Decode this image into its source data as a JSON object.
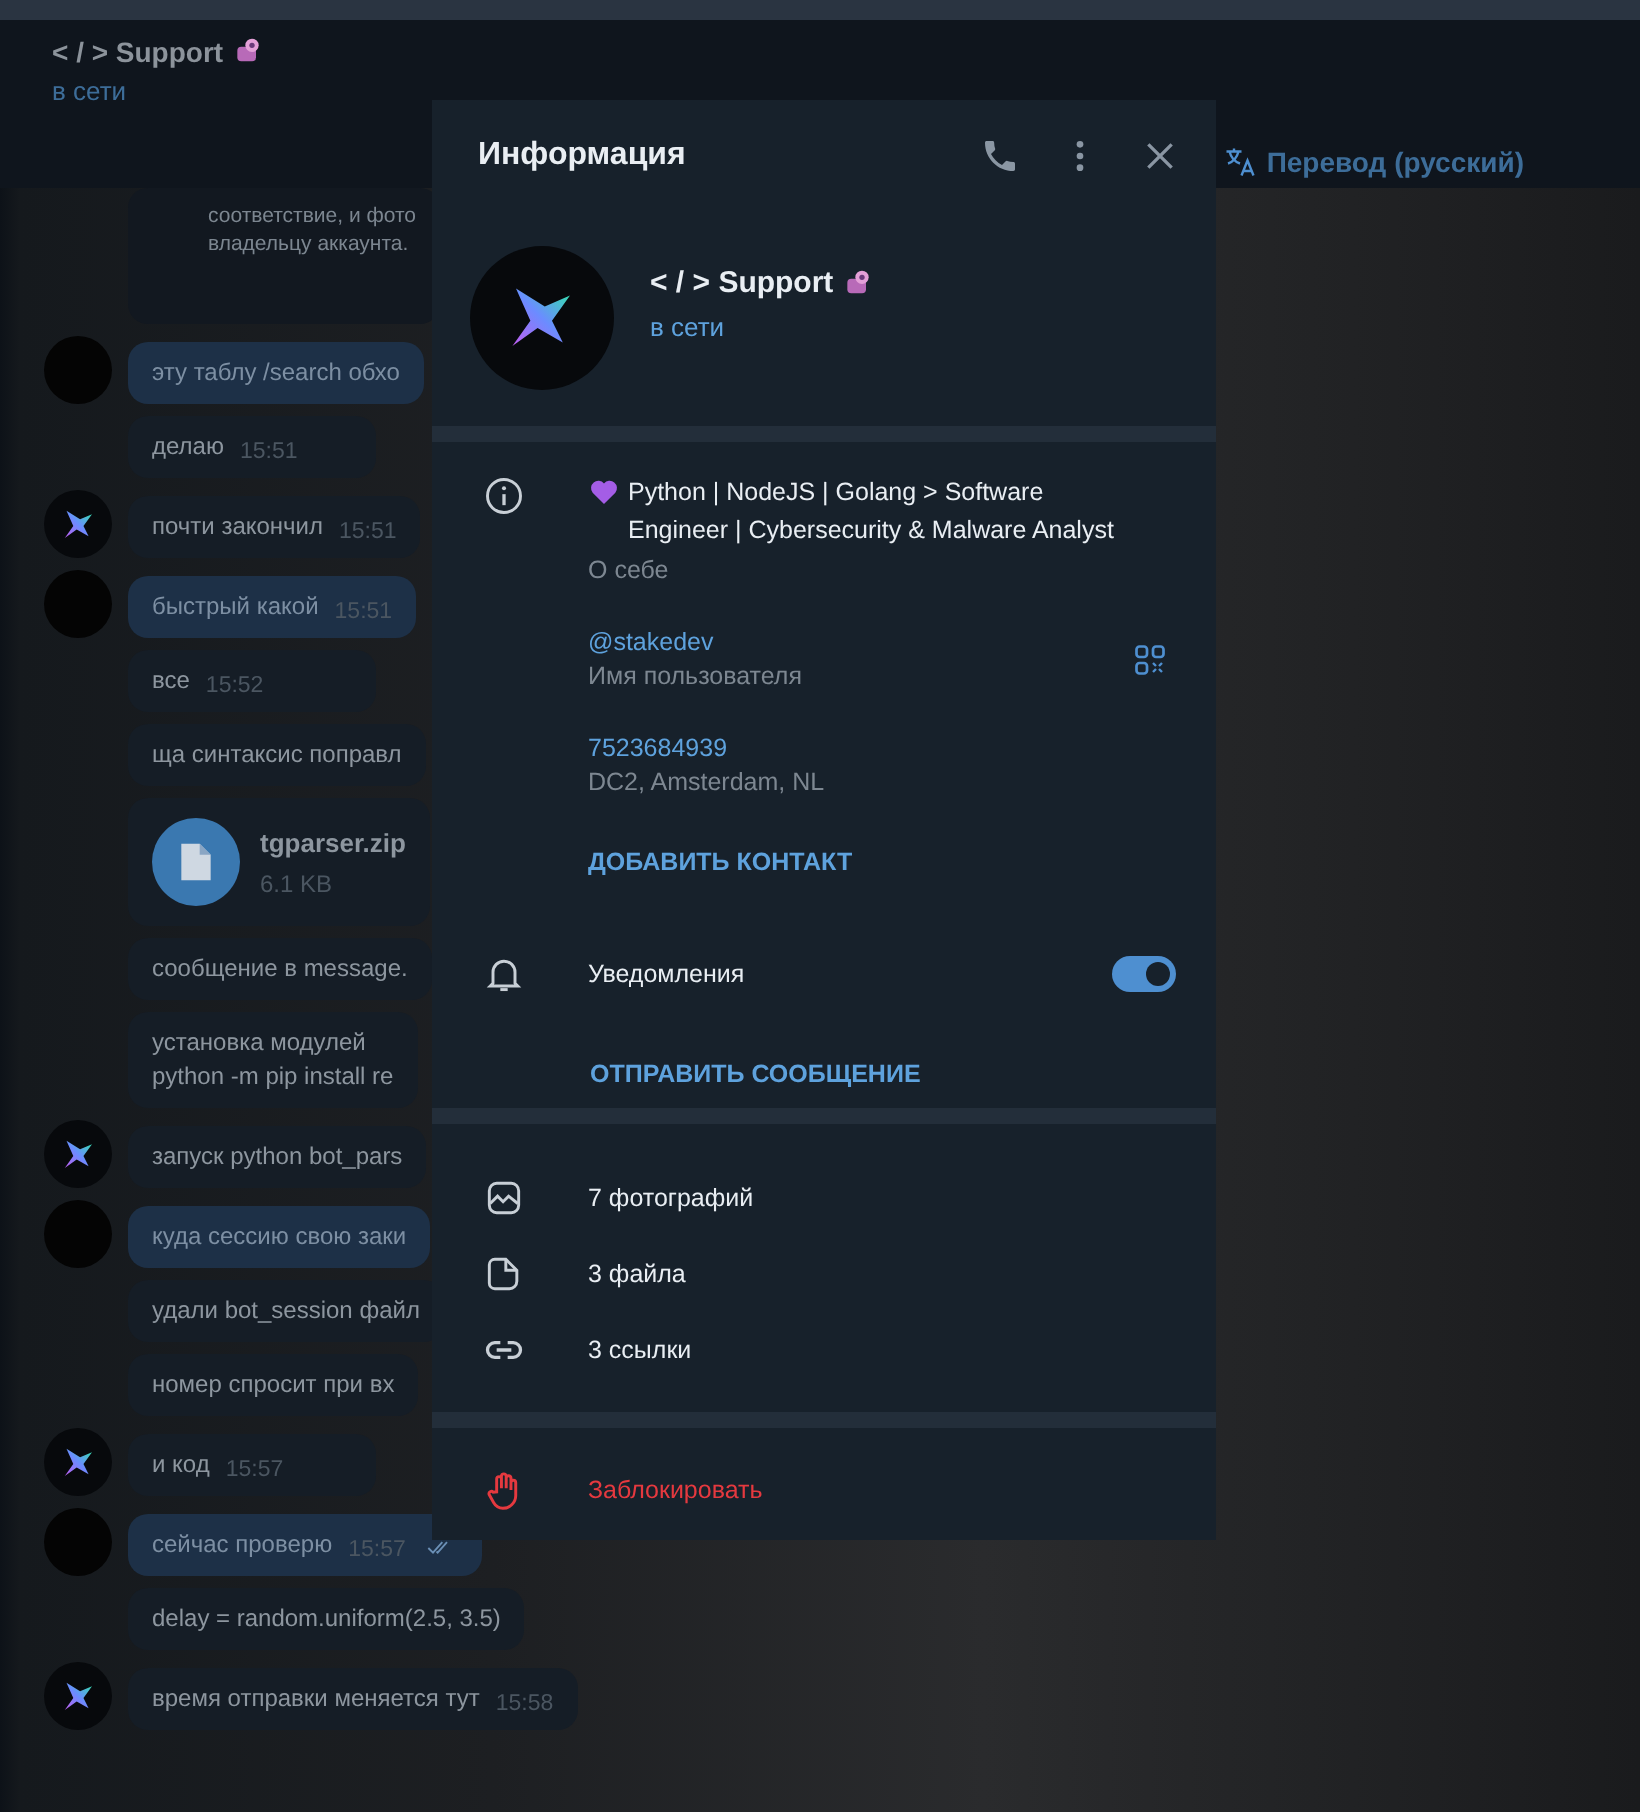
{
  "header": {
    "title": "< / > Support",
    "status": "в сети",
    "translate": "Перевод (русский)"
  },
  "messages": [
    {
      "kind": "card",
      "lines": [
        "соответствие, и фото",
        "владельцу аккаунта."
      ],
      "avatar": false
    },
    {
      "kind": "out",
      "lines": [
        "эту таблу /search обхо"
      ],
      "avatar": true
    },
    {
      "kind": "in",
      "lines": [
        "делаю"
      ],
      "time": "15:51",
      "avatar": false
    },
    {
      "kind": "in",
      "lines": [
        "почти закончил"
      ],
      "time": "15:51",
      "avatar": true
    },
    {
      "kind": "out",
      "lines": [
        "быстрый какой"
      ],
      "time": "15:51",
      "avatar": true
    },
    {
      "kind": "in",
      "lines": [
        "все"
      ],
      "time": "15:52",
      "avatar": false
    },
    {
      "kind": "in",
      "lines": [
        "ща синтаксис поправл"
      ],
      "avatar": false
    },
    {
      "kind": "file",
      "name": "tgparser.zip",
      "size": "6.1 KB",
      "avatar": false
    },
    {
      "kind": "in",
      "lines": [
        "сообщение в message."
      ],
      "avatar": false
    },
    {
      "kind": "in",
      "lines": [
        "установка модулей",
        "python -m pip install re"
      ],
      "avatar": false
    },
    {
      "kind": "in",
      "lines": [
        "запуск python bot_pars"
      ],
      "avatar": true
    },
    {
      "kind": "out",
      "lines": [
        "куда сессию свою заки"
      ],
      "avatar": true
    },
    {
      "kind": "in",
      "lines": [
        "удали bot_session файл"
      ],
      "avatar": false
    },
    {
      "kind": "in",
      "lines": [
        "номер спросит при вх"
      ],
      "avatar": false
    },
    {
      "kind": "in",
      "lines": [
        "и код"
      ],
      "time": "15:57",
      "avatar": true
    },
    {
      "kind": "out",
      "lines": [
        "сейчас проверю"
      ],
      "time": "15:57",
      "read": true,
      "avatar": true
    },
    {
      "kind": "in",
      "lines": [
        "delay = random.uniform(2.5, 3.5)"
      ],
      "avatar": false
    },
    {
      "kind": "in",
      "lines": [
        "время отправки меняется тут"
      ],
      "time": "15:58",
      "avatar": true
    }
  ],
  "info_panel": {
    "title": "Информация",
    "name": "< / > Support",
    "status": "в сети",
    "bio": "Python | NodeJS | Golang > Software Engineer | Cybersecurity & Malware Analyst",
    "bio_label": "О себе",
    "username": "@stakedev",
    "username_label": "Имя пользователя",
    "id": "7523684939",
    "id_label": "DC2, Amsterdam, NL",
    "add_contact": "ДОБАВИТЬ КОНТАКТ",
    "notifications": {
      "label": "Уведомления",
      "on": true
    },
    "send_message": "ОТПРАВИТЬ СООБЩЕНИЕ",
    "media": [
      {
        "kind": "photos",
        "label": "7 фотографий"
      },
      {
        "kind": "files",
        "label": "3 файла"
      },
      {
        "kind": "links",
        "label": "3 ссылки"
      }
    ],
    "block": "Заблокировать"
  }
}
